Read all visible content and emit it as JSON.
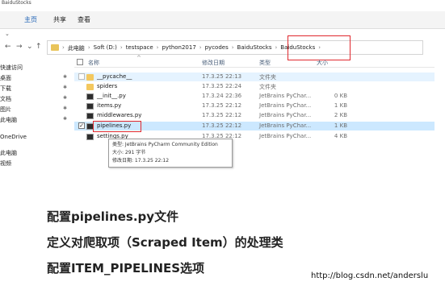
{
  "window": {
    "title_fragment": "BaiduStocks"
  },
  "ribbon": {
    "tabs": [
      "主页",
      "共享",
      "查看"
    ],
    "expand_chevron": "chevron-down-icon"
  },
  "nav": {
    "back": "←",
    "forward": "→",
    "dropdown": "⌄",
    "up": "↑",
    "breadcrumbs": [
      "此电脑",
      "Soft (D:)",
      "testspace",
      "python2017",
      "pycodes",
      "BaiduStocks",
      "BaiduStocks"
    ],
    "separator": "›",
    "trailing": "›"
  },
  "sidebar": {
    "items": [
      {
        "label": "快速访问",
        "pinned": false
      },
      {
        "label": "桌面",
        "pinned": true
      },
      {
        "label": "下载",
        "pinned": true
      },
      {
        "label": "文档",
        "pinned": true
      },
      {
        "label": "图片",
        "pinned": true
      },
      {
        "label": "此电脑",
        "pinned": true
      },
      {
        "label": "",
        "pinned": false
      },
      {
        "label": "OneDrive",
        "pinned": false
      },
      {
        "label": "",
        "pinned": false
      },
      {
        "label": "此电脑",
        "pinned": false
      },
      {
        "label": "视频",
        "pinned": false
      }
    ],
    "pin_glyph": "✱"
  },
  "filelist": {
    "columns": [
      "名称",
      "修改日期",
      "类型",
      "大小"
    ],
    "sort_indicator": "^",
    "rows": [
      {
        "name": "__pycache__",
        "date": "17.3.25 22:13",
        "type": "文件夹",
        "size": "",
        "icon": "folder",
        "state": "hover"
      },
      {
        "name": "spiders",
        "date": "17.3.25 22:24",
        "type": "文件夹",
        "size": "",
        "icon": "folder",
        "state": ""
      },
      {
        "name": "__init__.py",
        "date": "17.3.24 22:36",
        "type": "JetBrains PyChar...",
        "size": "0 KB",
        "icon": "pyfile",
        "state": ""
      },
      {
        "name": "items.py",
        "date": "17.3.25 22:12",
        "type": "JetBrains PyChar...",
        "size": "1 KB",
        "icon": "pyfile",
        "state": ""
      },
      {
        "name": "middlewares.py",
        "date": "17.3.25 22:12",
        "type": "JetBrains PyChar...",
        "size": "2 KB",
        "icon": "pyfile",
        "state": ""
      },
      {
        "name": "pipelines.py",
        "date": "17.3.25 22:12",
        "type": "JetBrains PyChar...",
        "size": "1 KB",
        "icon": "pyfile",
        "state": "selected"
      },
      {
        "name": "settings.py",
        "date": "17.3.25 22:12",
        "type": "JetBrains PyChar...",
        "size": "4 KB",
        "icon": "pyfile",
        "state": ""
      }
    ]
  },
  "tooltip": {
    "type_line": "类型: JetBrains PyCharm Community Edition",
    "size_line": "大小: 291 字节",
    "date_line": "修改日期: 17.3.25 22:12"
  },
  "notes": [
    "配置pipelines.py文件",
    "定义对爬取项（Scraped Item）的处理类",
    "配置ITEM_PIPELINES选项"
  ],
  "footer": {
    "url": "http://blog.csdn.net/anderslu"
  },
  "colors": {
    "highlight_box": "#e0282e",
    "selected_row": "#cce8ff",
    "folder": "#f3c85f"
  }
}
